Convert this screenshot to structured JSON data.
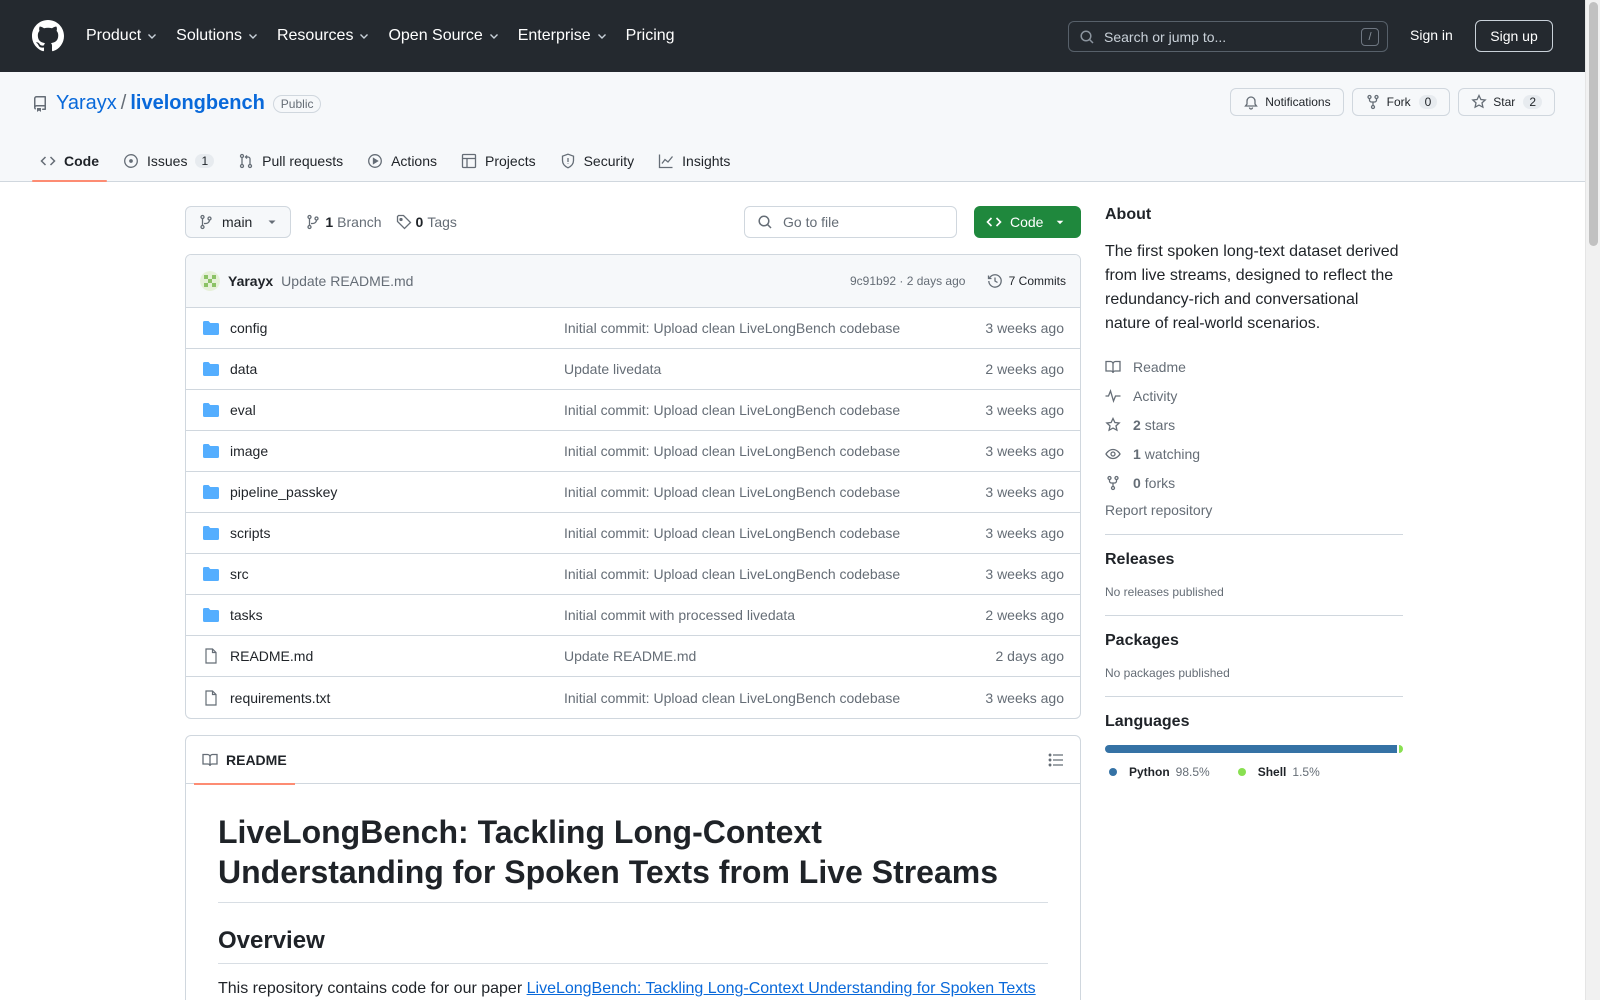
{
  "nav": {
    "items": [
      {
        "label": "Product",
        "has_menu": true
      },
      {
        "label": "Solutions",
        "has_menu": true
      },
      {
        "label": "Resources",
        "has_menu": true
      },
      {
        "label": "Open Source",
        "has_menu": true
      },
      {
        "label": "Enterprise",
        "has_menu": true
      },
      {
        "label": "Pricing",
        "has_menu": false
      }
    ],
    "search_placeholder": "Search or jump to...",
    "search_shortcut": "/",
    "signin": "Sign in",
    "signup": "Sign up"
  },
  "repo": {
    "owner": "Yarayx",
    "sep": "/",
    "name": "livelongbench",
    "visibility": "Public",
    "notifications_label": "Notifications",
    "fork_label": "Fork",
    "fork_count": "0",
    "star_label": "Star",
    "star_count": "2",
    "tabs": [
      {
        "label": "Code",
        "icon": "code-icon",
        "count": ""
      },
      {
        "label": "Issues",
        "icon": "issue-icon",
        "count": "1"
      },
      {
        "label": "Pull requests",
        "icon": "pull-request-icon",
        "count": ""
      },
      {
        "label": "Actions",
        "icon": "play-icon",
        "count": ""
      },
      {
        "label": "Projects",
        "icon": "table-icon",
        "count": ""
      },
      {
        "label": "Security",
        "icon": "shield-icon",
        "count": ""
      },
      {
        "label": "Insights",
        "icon": "graph-icon",
        "count": ""
      }
    ]
  },
  "toolbar": {
    "branch": "main",
    "branch_count": "1",
    "branch_label": "Branch",
    "tag_count": "0",
    "tag_label": "Tags",
    "gofile_placeholder": "Go to file",
    "code_label": "Code"
  },
  "commit": {
    "author": "Yarayx",
    "message": "Update README.md",
    "meta": "9c91b92 · 2 days ago",
    "commits_label": "7 Commits"
  },
  "files": [
    {
      "name": "config",
      "type": "dir",
      "message": "Initial commit: Upload clean LiveLongBench codebase",
      "date": "3 weeks ago"
    },
    {
      "name": "data",
      "type": "dir",
      "message": "Update livedata",
      "date": "2 weeks ago"
    },
    {
      "name": "eval",
      "type": "dir",
      "message": "Initial commit: Upload clean LiveLongBench codebase",
      "date": "3 weeks ago"
    },
    {
      "name": "image",
      "type": "dir",
      "message": "Initial commit: Upload clean LiveLongBench codebase",
      "date": "3 weeks ago"
    },
    {
      "name": "pipeline_passkey",
      "type": "dir",
      "message": "Initial commit: Upload clean LiveLongBench codebase",
      "date": "3 weeks ago"
    },
    {
      "name": "scripts",
      "type": "dir",
      "message": "Initial commit: Upload clean LiveLongBench codebase",
      "date": "3 weeks ago"
    },
    {
      "name": "src",
      "type": "dir",
      "message": "Initial commit: Upload clean LiveLongBench codebase",
      "date": "3 weeks ago"
    },
    {
      "name": "tasks",
      "type": "dir",
      "message": "Initial commit with processed livedata",
      "date": "2 weeks ago"
    },
    {
      "name": "README.md",
      "type": "file",
      "message": "Update README.md",
      "date": "2 days ago"
    },
    {
      "name": "requirements.txt",
      "type": "file",
      "message": "Initial commit: Upload clean LiveLongBench codebase",
      "date": "3 weeks ago"
    }
  ],
  "readme": {
    "tab_label": "README",
    "title": "LiveLongBench: Tackling Long-Context Understanding for Spoken Texts from Live Streams",
    "overview_heading": "Overview",
    "para_prefix": "This repository contains code for our paper ",
    "para_link": "LiveLongBench: Tackling Long-Context Understanding for Spoken Texts"
  },
  "about": {
    "heading": "About",
    "description": "The first spoken long-text dataset derived from live streams, designed to reflect the redundancy-rich and conversational nature of real-world scenarios.",
    "readme": "Readme",
    "activity": "Activity",
    "stars_count": "2",
    "stars_label": "stars",
    "watching_count": "1",
    "watching_label": "watching",
    "forks_count": "0",
    "forks_label": "forks",
    "report": "Report repository"
  },
  "releases": {
    "heading": "Releases",
    "text": "No releases published"
  },
  "packages": {
    "heading": "Packages",
    "text": "No packages published"
  },
  "languages": {
    "heading": "Languages",
    "items": [
      {
        "name": "Python",
        "percent": "98.5%",
        "value": 98.5,
        "color": "#3572a5"
      },
      {
        "name": "Shell",
        "percent": "1.5%",
        "value": 1.5,
        "color": "#89e051"
      }
    ]
  },
  "colors": {
    "accent": "#0969da",
    "primary_button": "#1f883d",
    "active_tab": "#fd8c73",
    "header_bg": "#24292f"
  }
}
